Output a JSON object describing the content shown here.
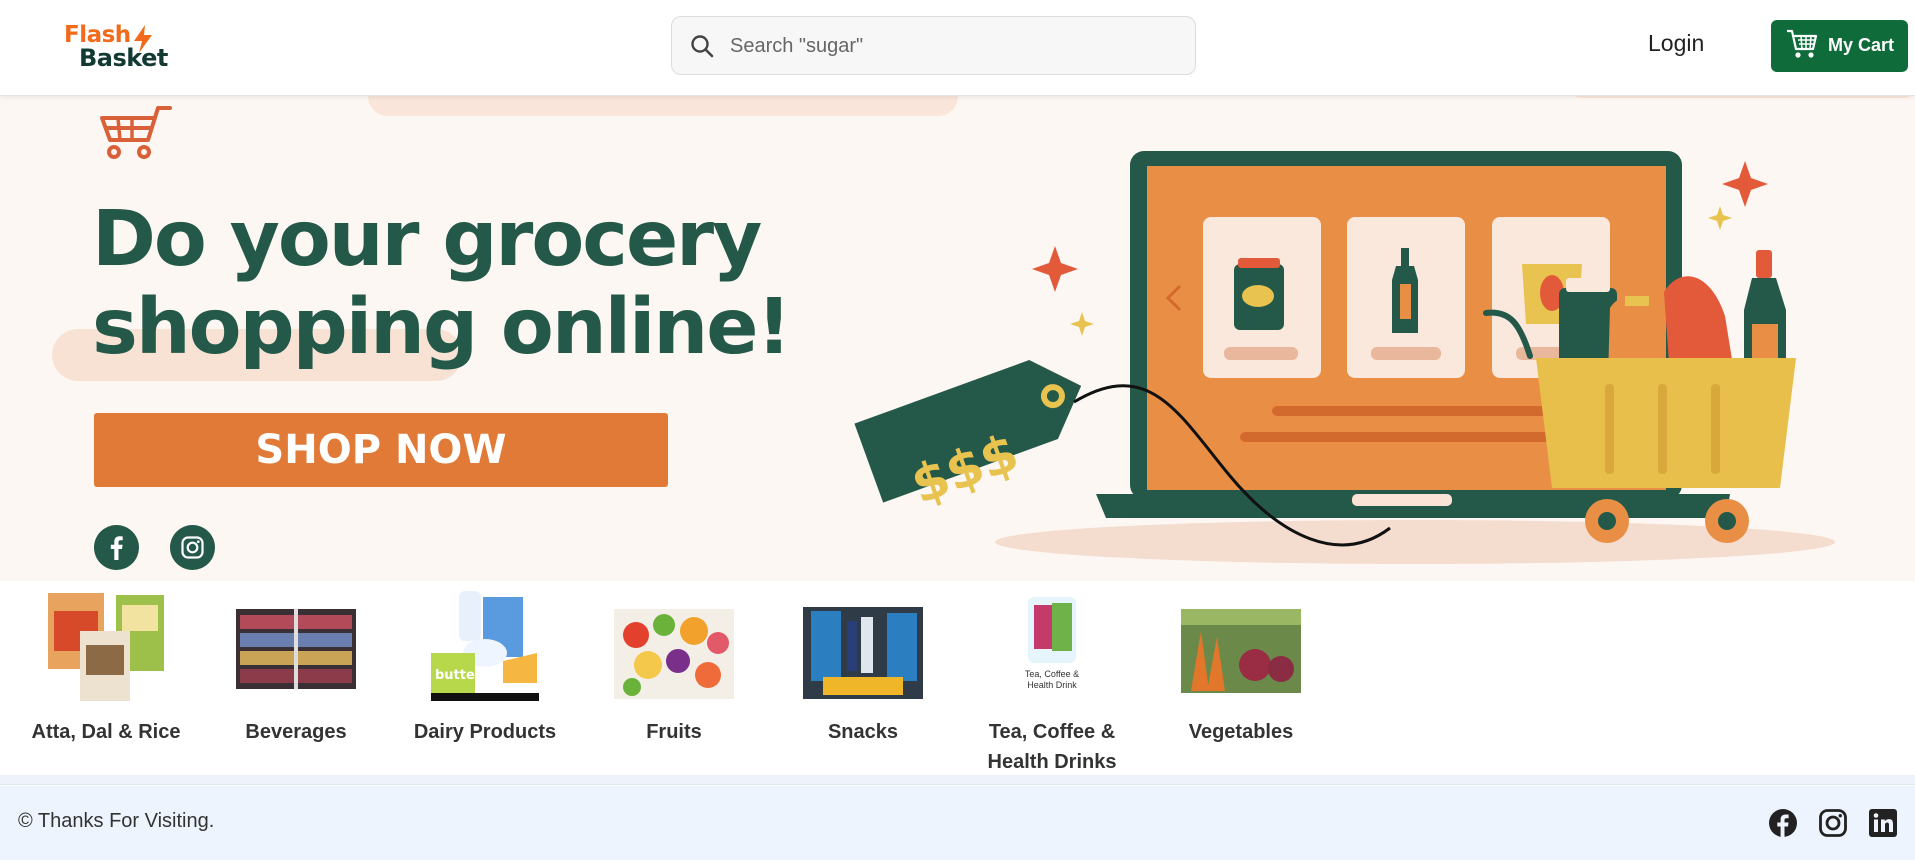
{
  "header": {
    "logo_line1": "Flash",
    "logo_line2": "Basket",
    "search_placeholder": "Search \"sugar\"",
    "login_label": "Login",
    "cart_label": "My Cart"
  },
  "hero": {
    "headline_line1": "Do your grocery",
    "headline_line2": "shopping online!",
    "cta_label": "SHOP NOW",
    "price_tag_text": "$$$",
    "social": [
      "facebook-icon",
      "instagram-icon"
    ]
  },
  "categories": [
    {
      "label": "Atta, Dal & Rice",
      "icon": "atta-dal-rice-image"
    },
    {
      "label": "Beverages",
      "icon": "beverages-image"
    },
    {
      "label": "Dairy Products",
      "icon": "dairy-products-image"
    },
    {
      "label": "Fruits",
      "icon": "fruits-image"
    },
    {
      "label": "Snacks",
      "icon": "snacks-image"
    },
    {
      "label": "Tea, Coffee & Health Drinks",
      "icon": "tea-coffee-image",
      "image_caption": "Tea, Coffee & Health Drink"
    },
    {
      "label": "Vegetables",
      "icon": "vegetables-image"
    }
  ],
  "footer": {
    "copyright": "© Thanks For Visiting.",
    "social": [
      "facebook-icon",
      "instagram-icon",
      "linkedin-icon"
    ]
  },
  "colors": {
    "brand_green": "#0f6b3a",
    "headline_green": "#245949",
    "cta_orange": "#e07a36",
    "logo_orange": "#f26a1b",
    "hero_bg": "#fdf7f3",
    "footer_bg": "#eef4fd"
  }
}
